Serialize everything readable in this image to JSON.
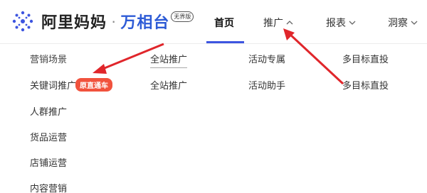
{
  "brand": {
    "name": "阿里妈妈",
    "dot": "·",
    "product": "万相台",
    "badge": "无界版"
  },
  "nav": {
    "items": [
      {
        "label": "首页",
        "active": true
      },
      {
        "label": "推广",
        "chevron": "^"
      },
      {
        "label": "报表",
        "chevron": "v"
      },
      {
        "label": "洞察",
        "chevron": "v"
      }
    ]
  },
  "menu": {
    "col1": [
      "营销场景",
      "关键词推广",
      "人群推广",
      "货品运营",
      "店铺运营",
      "内容营销"
    ],
    "col1_tag": "原直通车",
    "col2": [
      "全站推广",
      "全站推广"
    ],
    "col3": [
      "活动专属",
      "活动助手"
    ],
    "col4": [
      "多目标直投",
      "多目标直投"
    ]
  },
  "colors": {
    "accent": "#3d55e0",
    "tag": "#f1523d",
    "arrow": "#e0262b"
  }
}
